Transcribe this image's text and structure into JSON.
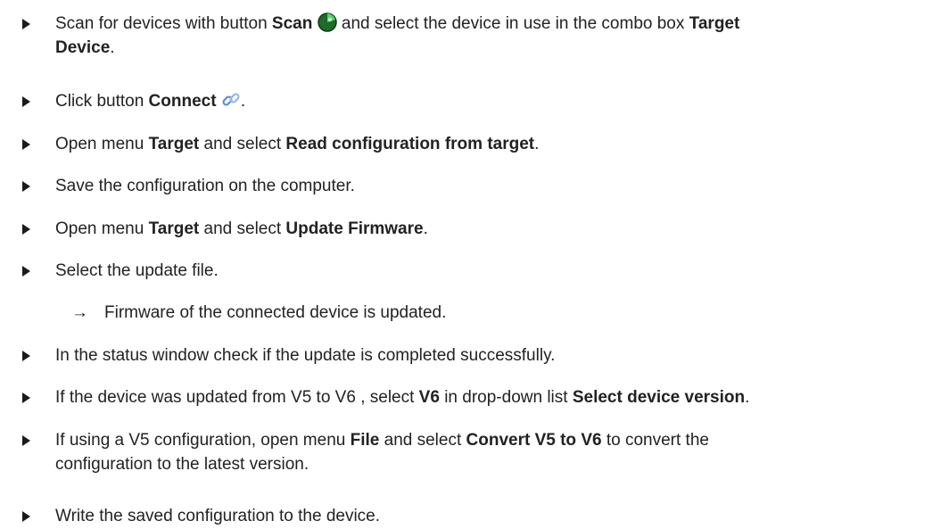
{
  "steps": [
    {
      "t1": "Scan for devices with button ",
      "b1": "Scan",
      "icon": "scan-radar-icon",
      "t2": " and select the device in use in the combo box ",
      "b2": "Target",
      "line2_bold": "Device",
      "line2_rest": "."
    },
    {
      "t1": "Click button ",
      "b1": "Connect",
      "icon": "connect-chain-link-icon",
      "t2": "."
    },
    {
      "t1": "Open menu ",
      "b1": "Target",
      "t2": " and select ",
      "b2": "Read configuration from target",
      "t3": "."
    },
    {
      "t1": "Save the configuration on the computer."
    },
    {
      "t1": "Open menu ",
      "b1": "Target",
      "t2": " and select ",
      "b2": "Update Firmware",
      "t3": "."
    },
    {
      "t1": "Select the update file.",
      "result_arrow": "→",
      "result": "Firmware of the connected device is updated."
    },
    {
      "t1": "In the status window check if the update is completed successfully."
    },
    {
      "t1": "If the device was updated from V5 to V6 , select ",
      "b1": "V6",
      "t2": " in drop-down list ",
      "b2": "Select device version",
      "t3": "."
    },
    {
      "t1": "If using a V5 configuration, open menu ",
      "b1": "File",
      "t2": " and select ",
      "b2": "Convert V5 to V6",
      "t3": " to convert the",
      "line2": "configuration to the latest version."
    },
    {
      "t1": "Write the saved configuration to the device."
    }
  ]
}
